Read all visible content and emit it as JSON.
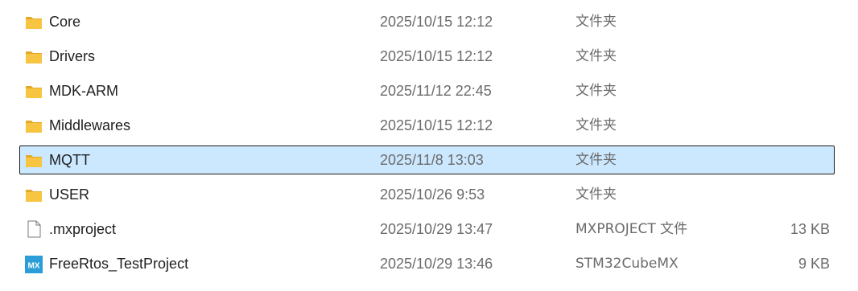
{
  "files": [
    {
      "name": "Core",
      "date": "2025/10/15 12:12",
      "type": "文件夹",
      "size": "",
      "icon": "folder-icon",
      "selected": false
    },
    {
      "name": "Drivers",
      "date": "2025/10/15 12:12",
      "type": "文件夹",
      "size": "",
      "icon": "folder-icon",
      "selected": false
    },
    {
      "name": "MDK-ARM",
      "date": "2025/11/12 22:45",
      "type": "文件夹",
      "size": "",
      "icon": "folder-icon",
      "selected": false
    },
    {
      "name": "Middlewares",
      "date": "2025/10/15 12:12",
      "type": "文件夹",
      "size": "",
      "icon": "folder-icon",
      "selected": false
    },
    {
      "name": "MQTT",
      "date": "2025/11/8 13:03",
      "type": "文件夹",
      "size": "",
      "icon": "folder-icon",
      "selected": true
    },
    {
      "name": "USER",
      "date": "2025/10/26 9:53",
      "type": "文件夹",
      "size": "",
      "icon": "folder-icon",
      "selected": false
    },
    {
      "name": ".mxproject",
      "date": "2025/10/29 13:47",
      "type": "MXPROJECT 文件",
      "size": "13 KB",
      "icon": "file-icon",
      "selected": false
    },
    {
      "name": "FreeRtos_TestProject",
      "date": "2025/10/29 13:46",
      "type": "STM32CubeMX",
      "size": "9 KB",
      "icon": "stm32cubemx-icon",
      "icon_text": "MX",
      "selected": false
    }
  ],
  "colors": {
    "selection_bg": "#cce8ff",
    "selection_border": "#1b1b1b",
    "folder": "#f8c542",
    "mx_icon": "#2b9ed9"
  }
}
